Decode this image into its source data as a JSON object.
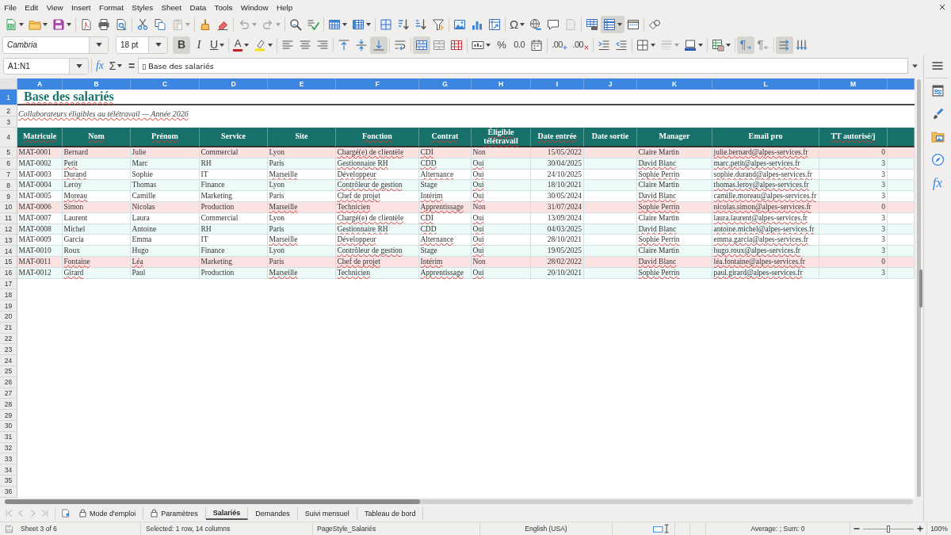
{
  "menu_bar": {
    "items": [
      "File",
      "Edit",
      "View",
      "Insert",
      "Format",
      "Styles",
      "Sheet",
      "Data",
      "Tools",
      "Window",
      "Help"
    ]
  },
  "standard_toolbar": [
    {
      "dropdown": true,
      "pressed": false,
      "disabled": false
    },
    {
      "dropdown": true,
      "pressed": false,
      "disabled": false
    },
    {
      "dropdown": true,
      "pressed": false,
      "disabled": false
    },
    {
      "dropdown": false,
      "pressed": false,
      "disabled": false
    },
    {
      "dropdown": false,
      "pressed": false,
      "disabled": false
    },
    {
      "dropdown": false,
      "pressed": false,
      "disabled": false
    },
    {
      "dropdown": false,
      "pressed": false,
      "disabled": false
    },
    {
      "dropdown": false,
      "pressed": false,
      "disabled": false
    },
    {
      "dropdown": true,
      "pressed": false,
      "disabled": true
    },
    {
      "dropdown": false,
      "pressed": false,
      "disabled": false
    },
    {
      "dropdown": false,
      "pressed": false,
      "disabled": false
    },
    {
      "dropdown": true,
      "pressed": false,
      "disabled": true
    },
    {
      "dropdown": true,
      "pressed": false,
      "disabled": true
    },
    {
      "dropdown": false,
      "pressed": false,
      "disabled": false
    },
    {
      "dropdown": false,
      "pressed": false,
      "disabled": false
    },
    {
      "dropdown": true,
      "pressed": false,
      "disabled": false
    },
    {
      "dropdown": true,
      "pressed": false,
      "disabled": false
    },
    {
      "dropdown": false,
      "pressed": false,
      "disabled": false
    },
    {
      "dropdown": false,
      "pressed": false,
      "disabled": false
    },
    {
      "dropdown": false,
      "pressed": false,
      "disabled": false
    },
    {
      "dropdown": false,
      "pressed": false,
      "disabled": false
    },
    {
      "dropdown": false,
      "pressed": false,
      "disabled": false
    },
    {
      "dropdown": false,
      "pressed": false,
      "disabled": false
    },
    {
      "dropdown": false,
      "pressed": false,
      "disabled": false
    },
    {
      "glyph": "Ω",
      "dropdown": true,
      "pressed": false,
      "disabled": false
    },
    {
      "dropdown": false,
      "pressed": false,
      "disabled": false
    },
    {
      "dropdown": false,
      "pressed": false,
      "disabled": false
    },
    {
      "dropdown": false,
      "pressed": false,
      "disabled": true
    },
    {
      "dropdown": false,
      "pressed": false,
      "disabled": false
    },
    {
      "dropdown": true,
      "pressed": true,
      "disabled": false
    },
    {
      "dropdown": false,
      "pressed": false,
      "disabled": false
    },
    {
      "dropdown": false,
      "pressed": false,
      "disabled": false
    }
  ],
  "formatting_toolbar": {
    "font_name": "Cambria",
    "font_size": "18 pt",
    "buttons": [
      {
        "glyph": "B",
        "dropdown": false,
        "pressed": true,
        "disabled": false
      },
      {
        "glyph": "I",
        "dropdown": false,
        "pressed": false,
        "disabled": false
      },
      {
        "glyph": "U",
        "dropdown": true,
        "pressed": false,
        "disabled": false
      },
      {
        "glyph": "A",
        "dropdown": true,
        "pressed": false,
        "disabled": false
      },
      {
        "dropdown": true,
        "pressed": false,
        "disabled": false
      },
      {
        "dropdown": false,
        "pressed": false,
        "disabled": false
      },
      {
        "dropdown": false,
        "pressed": false,
        "disabled": false
      },
      {
        "dropdown": false,
        "pressed": false,
        "disabled": false
      },
      {
        "dropdown": false,
        "pressed": false,
        "disabled": false
      },
      {
        "dropdown": false,
        "pressed": false,
        "disabled": false
      },
      {
        "dropdown": false,
        "pressed": true,
        "disabled": false
      },
      {
        "dropdown": false,
        "pressed": false,
        "disabled": false
      },
      {
        "dropdown": false,
        "pressed": true,
        "disabled": false
      },
      {
        "dropdown": false,
        "pressed": false,
        "disabled": false
      },
      {
        "dropdown": false,
        "pressed": false,
        "disabled": false
      },
      {
        "dropdown": true,
        "pressed": false,
        "disabled": false
      },
      {
        "glyph": "%",
        "dropdown": false,
        "pressed": false,
        "disabled": false
      },
      {
        "glyph": "0.0",
        "dropdown": false,
        "pressed": false,
        "disabled": false
      },
      {
        "dropdown": false,
        "pressed": false,
        "disabled": false
      },
      {
        "glyph": ".00",
        "dropdown": false,
        "pressed": false,
        "disabled": false
      },
      {
        "glyph": ".00",
        "dropdown": false,
        "pressed": false,
        "disabled": false
      },
      {
        "dropdown": false,
        "pressed": false,
        "disabled": false
      },
      {
        "dropdown": false,
        "pressed": false,
        "disabled": false
      },
      {
        "dropdown": true,
        "pressed": false,
        "disabled": false
      },
      {
        "dropdown": true,
        "pressed": false,
        "disabled": true
      },
      {
        "dropdown": true,
        "pressed": false,
        "disabled": false
      },
      {
        "dropdown": true,
        "pressed": false,
        "disabled": false
      },
      {
        "glyph": "¶",
        "dropdown": false,
        "pressed": true,
        "disabled": false
      },
      {
        "glyph": "¶",
        "dropdown": false,
        "pressed": false,
        "disabled": false
      },
      {
        "dropdown": false,
        "pressed": true,
        "disabled": false
      },
      {
        "dropdown": false,
        "pressed": false,
        "disabled": false
      }
    ]
  },
  "formula_bar": {
    "name_box": "A1:N1",
    "function_wizard": "fx",
    "sum": "Σ",
    "formula": "=",
    "content": "▯ Base des salariés"
  },
  "sheet": {
    "column_headers": [
      {
        "label": "A",
        "selected": true
      },
      {
        "label": "B",
        "selected": true
      },
      {
        "label": "C",
        "selected": true
      },
      {
        "label": "D",
        "selected": true
      },
      {
        "label": "E",
        "selected": true
      },
      {
        "label": "F",
        "selected": true
      },
      {
        "label": "G",
        "selected": true
      },
      {
        "label": "H",
        "selected": true
      },
      {
        "label": "I",
        "selected": true
      },
      {
        "label": "J",
        "selected": true
      },
      {
        "label": "K",
        "selected": true
      },
      {
        "label": "L",
        "selected": true
      },
      {
        "label": "M",
        "selected": true
      }
    ],
    "row_headers": [
      {
        "label": "1",
        "selected": true
      },
      {
        "label": "2",
        "selected": false
      },
      {
        "label": "3",
        "selected": false
      },
      {
        "label": "4",
        "selected": false
      },
      {
        "label": "5",
        "selected": false
      },
      {
        "label": "6",
        "selected": false
      },
      {
        "label": "7",
        "selected": false
      },
      {
        "label": "8",
        "selected": false
      },
      {
        "label": "9",
        "selected": false
      },
      {
        "label": "10",
        "selected": false
      },
      {
        "label": "11",
        "selected": false
      },
      {
        "label": "12",
        "selected": false
      },
      {
        "label": "13",
        "selected": false
      },
      {
        "label": "14",
        "selected": false
      },
      {
        "label": "15",
        "selected": false
      },
      {
        "label": "16",
        "selected": false
      },
      {
        "label": "17",
        "selected": false
      },
      {
        "label": "18",
        "selected": false
      },
      {
        "label": "19",
        "selected": false
      },
      {
        "label": "20",
        "selected": false
      },
      {
        "label": "21",
        "selected": false
      },
      {
        "label": "22",
        "selected": false
      },
      {
        "label": "23",
        "selected": false
      },
      {
        "label": "24",
        "selected": false
      },
      {
        "label": "25",
        "selected": false
      },
      {
        "label": "26",
        "selected": false
      },
      {
        "label": "27",
        "selected": false
      },
      {
        "label": "28",
        "selected": false
      },
      {
        "label": "29",
        "selected": false
      },
      {
        "label": "30",
        "selected": false
      },
      {
        "label": "31",
        "selected": false
      },
      {
        "label": "32",
        "selected": false
      },
      {
        "label": "33",
        "selected": false
      },
      {
        "label": "34",
        "selected": false
      },
      {
        "label": "35",
        "selected": false
      },
      {
        "label": "36",
        "selected": false
      }
    ],
    "title": {
      "text": "Base des salariés",
      "misspelled": true
    },
    "subtitle": {
      "text": "Collaborateurs éligibles au télétravail — Année 2026",
      "misspelled": true
    },
    "columns": [
      {
        "label": "Matricule",
        "misspelled": true
      },
      {
        "label": "Nom",
        "misspelled": true
      },
      {
        "label": "Prénom",
        "misspelled": true
      },
      {
        "label": "Service",
        "misspelled": false
      },
      {
        "label": "Site",
        "misspelled": false
      },
      {
        "label": "Fonction",
        "misspelled": true
      },
      {
        "label": "Contrat",
        "misspelled": true
      },
      {
        "label": "Éligible télétravail",
        "misspelled": true
      },
      {
        "label": "Date entrée",
        "misspelled": true
      },
      {
        "label": "Date sortie",
        "misspelled": false
      },
      {
        "label": "Manager",
        "misspelled": false
      },
      {
        "label": "Email pro",
        "misspelled": false
      },
      {
        "label": "TT autorisé/j",
        "misspelled": true
      }
    ],
    "rows": [
      {
        "highlighted": true,
        "matricule": {
          "text": "MAT-0001",
          "misspelled": false
        },
        "nom": {
          "text": "Bernard",
          "misspelled": false
        },
        "prenom": {
          "text": "Julie",
          "misspelled": false
        },
        "service": {
          "text": "Commercial",
          "misspelled": false
        },
        "site": {
          "text": "Lyon",
          "misspelled": false
        },
        "fonction": {
          "text": "Chargé(e) de clientèle",
          "misspelled": true
        },
        "contrat": {
          "text": "CDI",
          "misspelled": true
        },
        "eligible": {
          "text": "Non",
          "misspelled": false
        },
        "date_entree": {
          "text": "15/05/2022",
          "misspelled": false
        },
        "manager": {
          "text": "Claire Martin",
          "misspelled": false
        },
        "email": {
          "text": "julie.bernard@alpes-services.fr",
          "misspelled": true
        },
        "tt": {
          "text": "0",
          "misspelled": false
        }
      },
      {
        "highlighted": false,
        "matricule": {
          "text": "MAT-0002",
          "misspelled": false
        },
        "nom": {
          "text": "Petit",
          "misspelled": true
        },
        "prenom": {
          "text": "Marc",
          "misspelled": false
        },
        "service": {
          "text": "RH",
          "misspelled": false
        },
        "site": {
          "text": "Paris",
          "misspelled": false
        },
        "fonction": {
          "text": "Gestionnaire RH",
          "misspelled": true
        },
        "contrat": {
          "text": "CDD",
          "misspelled": true
        },
        "eligible": {
          "text": "Oui",
          "misspelled": true
        },
        "date_entree": {
          "text": "30/04/2025",
          "misspelled": false
        },
        "manager": {
          "text": "David Blanc",
          "misspelled": true
        },
        "email": {
          "text": "marc.petit@alpes-services.fr",
          "misspelled": true
        },
        "tt": {
          "text": "3",
          "misspelled": false
        }
      },
      {
        "highlighted": false,
        "matricule": {
          "text": "MAT-0003",
          "misspelled": false
        },
        "nom": {
          "text": "Durand",
          "misspelled": true
        },
        "prenom": {
          "text": "Sophie",
          "misspelled": false
        },
        "service": {
          "text": "IT",
          "misspelled": false
        },
        "site": {
          "text": "Marseille",
          "misspelled": true
        },
        "fonction": {
          "text": "Développeur",
          "misspelled": true
        },
        "contrat": {
          "text": "Alternance",
          "misspelled": true
        },
        "eligible": {
          "text": "Oui",
          "misspelled": true
        },
        "date_entree": {
          "text": "24/10/2025",
          "misspelled": false
        },
        "manager": {
          "text": "Sophie Perrin",
          "misspelled": true
        },
        "email": {
          "text": "sophie.durand@alpes-services.fr",
          "misspelled": true
        },
        "tt": {
          "text": "3",
          "misspelled": false
        }
      },
      {
        "highlighted": false,
        "matricule": {
          "text": "MAT-0004",
          "misspelled": false
        },
        "nom": {
          "text": "Leroy",
          "misspelled": false
        },
        "prenom": {
          "text": "Thomas",
          "misspelled": false
        },
        "service": {
          "text": "Finance",
          "misspelled": false
        },
        "site": {
          "text": "Lyon",
          "misspelled": false
        },
        "fonction": {
          "text": "Contrôleur de gestion",
          "misspelled": true
        },
        "contrat": {
          "text": "Stage",
          "misspelled": false
        },
        "eligible": {
          "text": "Oui",
          "misspelled": true
        },
        "date_entree": {
          "text": "18/10/2021",
          "misspelled": false
        },
        "manager": {
          "text": "Claire Martin",
          "misspelled": false
        },
        "email": {
          "text": "thomas.leroy@alpes-services.fr",
          "misspelled": true
        },
        "tt": {
          "text": "3",
          "misspelled": false
        }
      },
      {
        "highlighted": false,
        "matricule": {
          "text": "MAT-0005",
          "misspelled": false
        },
        "nom": {
          "text": "Moreau",
          "misspelled": true
        },
        "prenom": {
          "text": "Camille",
          "misspelled": false
        },
        "service": {
          "text": "Marketing",
          "misspelled": false
        },
        "site": {
          "text": "Paris",
          "misspelled": false
        },
        "fonction": {
          "text": "Chef de projet",
          "misspelled": true
        },
        "contrat": {
          "text": "Intérim",
          "misspelled": true
        },
        "eligible": {
          "text": "Oui",
          "misspelled": true
        },
        "date_entree": {
          "text": "30/05/2024",
          "misspelled": false
        },
        "manager": {
          "text": "David Blanc",
          "misspelled": true
        },
        "email": {
          "text": "camille.moreau@alpes-services.fr",
          "misspelled": true
        },
        "tt": {
          "text": "3",
          "misspelled": false
        }
      },
      {
        "highlighted": true,
        "matricule": {
          "text": "MAT-0006",
          "misspelled": false
        },
        "nom": {
          "text": "Simon",
          "misspelled": false
        },
        "prenom": {
          "text": "Nicolas",
          "misspelled": false
        },
        "service": {
          "text": "Production",
          "misspelled": false
        },
        "site": {
          "text": "Marseille",
          "misspelled": true
        },
        "fonction": {
          "text": "Technicien",
          "misspelled": true
        },
        "contrat": {
          "text": "Apprentissage",
          "misspelled": true
        },
        "eligible": {
          "text": "Non",
          "misspelled": false
        },
        "date_entree": {
          "text": "31/07/2024",
          "misspelled": false
        },
        "manager": {
          "text": "Sophie Perrin",
          "misspelled": true
        },
        "email": {
          "text": "nicolas.simon@alpes-services.fr",
          "misspelled": true
        },
        "tt": {
          "text": "0",
          "misspelled": false
        }
      },
      {
        "highlighted": false,
        "matricule": {
          "text": "MAT-0007",
          "misspelled": false
        },
        "nom": {
          "text": "Laurent",
          "misspelled": false
        },
        "prenom": {
          "text": "Laura",
          "misspelled": false
        },
        "service": {
          "text": "Commercial",
          "misspelled": false
        },
        "site": {
          "text": "Lyon",
          "misspelled": false
        },
        "fonction": {
          "text": "Chargé(e) de clientèle",
          "misspelled": true
        },
        "contrat": {
          "text": "CDI",
          "misspelled": true
        },
        "eligible": {
          "text": "Oui",
          "misspelled": true
        },
        "date_entree": {
          "text": "13/09/2024",
          "misspelled": false
        },
        "manager": {
          "text": "Claire Martin",
          "misspelled": false
        },
        "email": {
          "text": "laura.laurent@alpes-services.fr",
          "misspelled": true
        },
        "tt": {
          "text": "3",
          "misspelled": false
        }
      },
      {
        "highlighted": false,
        "matricule": {
          "text": "MAT-0008",
          "misspelled": false
        },
        "nom": {
          "text": "Michel",
          "misspelled": false
        },
        "prenom": {
          "text": "Antoine",
          "misspelled": false
        },
        "service": {
          "text": "RH",
          "misspelled": false
        },
        "site": {
          "text": "Paris",
          "misspelled": false
        },
        "fonction": {
          "text": "Gestionnaire RH",
          "misspelled": true
        },
        "contrat": {
          "text": "CDD",
          "misspelled": true
        },
        "eligible": {
          "text": "Oui",
          "misspelled": true
        },
        "date_entree": {
          "text": "04/03/2025",
          "misspelled": false
        },
        "manager": {
          "text": "David Blanc",
          "misspelled": true
        },
        "email": {
          "text": "antoine.michel@alpes-services.fr",
          "misspelled": true
        },
        "tt": {
          "text": "3",
          "misspelled": false
        }
      },
      {
        "highlighted": false,
        "matricule": {
          "text": "MAT-0009",
          "misspelled": false
        },
        "nom": {
          "text": "Garcia",
          "misspelled": false
        },
        "prenom": {
          "text": "Emma",
          "misspelled": false
        },
        "service": {
          "text": "IT",
          "misspelled": false
        },
        "site": {
          "text": "Marseille",
          "misspelled": true
        },
        "fonction": {
          "text": "Développeur",
          "misspelled": true
        },
        "contrat": {
          "text": "Alternance",
          "misspelled": true
        },
        "eligible": {
          "text": "Oui",
          "misspelled": true
        },
        "date_entree": {
          "text": "28/10/2021",
          "misspelled": false
        },
        "manager": {
          "text": "Sophie Perrin",
          "misspelled": true
        },
        "email": {
          "text": "emma.garcia@alpes-services.fr",
          "misspelled": true
        },
        "tt": {
          "text": "3",
          "misspelled": false
        }
      },
      {
        "highlighted": false,
        "matricule": {
          "text": "MAT-0010",
          "misspelled": false
        },
        "nom": {
          "text": "Roux",
          "misspelled": false
        },
        "prenom": {
          "text": "Hugo",
          "misspelled": false
        },
        "service": {
          "text": "Finance",
          "misspelled": false
        },
        "site": {
          "text": "Lyon",
          "misspelled": false
        },
        "fonction": {
          "text": "Contrôleur de gestion",
          "misspelled": true
        },
        "contrat": {
          "text": "Stage",
          "misspelled": false
        },
        "eligible": {
          "text": "Oui",
          "misspelled": true
        },
        "date_entree": {
          "text": "19/05/2025",
          "misspelled": false
        },
        "manager": {
          "text": "Claire Martin",
          "misspelled": false
        },
        "email": {
          "text": "hugo.roux@alpes-services.fr",
          "misspelled": true
        },
        "tt": {
          "text": "3",
          "misspelled": false
        }
      },
      {
        "highlighted": true,
        "matricule": {
          "text": "MAT-0011",
          "misspelled": false
        },
        "nom": {
          "text": "Fontaine",
          "misspelled": true
        },
        "prenom": {
          "text": "Léa",
          "misspelled": true
        },
        "service": {
          "text": "Marketing",
          "misspelled": false
        },
        "site": {
          "text": "Paris",
          "misspelled": false
        },
        "fonction": {
          "text": "Chef de projet",
          "misspelled": true
        },
        "contrat": {
          "text": "Intérim",
          "misspelled": true
        },
        "eligible": {
          "text": "Non",
          "misspelled": false
        },
        "date_entree": {
          "text": "28/02/2022",
          "misspelled": false
        },
        "manager": {
          "text": "David Blanc",
          "misspelled": true
        },
        "email": {
          "text": "léa.fontaine@alpes-services.fr",
          "misspelled": true
        },
        "tt": {
          "text": "0",
          "misspelled": false
        }
      },
      {
        "highlighted": false,
        "matricule": {
          "text": "MAT-0012",
          "misspelled": false
        },
        "nom": {
          "text": "Girard",
          "misspelled": true
        },
        "prenom": {
          "text": "Paul",
          "misspelled": false
        },
        "service": {
          "text": "Production",
          "misspelled": false
        },
        "site": {
          "text": "Marseille",
          "misspelled": true
        },
        "fonction": {
          "text": "Technicien",
          "misspelled": true
        },
        "contrat": {
          "text": "Apprentissage",
          "misspelled": true
        },
        "eligible": {
          "text": "Oui",
          "misspelled": true
        },
        "date_entree": {
          "text": "20/10/2021",
          "misspelled": false
        },
        "manager": {
          "text": "Sophie Perrin",
          "misspelled": true
        },
        "email": {
          "text": "paul.girard@alpes-services.fr",
          "misspelled": true
        },
        "tt": {
          "text": "3",
          "misspelled": false
        }
      }
    ]
  },
  "sidebar": {
    "functions_tab": "fx"
  },
  "sheet_navigation": [
    {
      "disabled": true
    },
    {
      "disabled": true
    },
    {
      "disabled": true
    },
    {
      "disabled": true
    }
  ],
  "sheet_tabs": [
    {
      "label": "Mode d'emploi",
      "locked": true,
      "selected": false
    },
    {
      "label": "Paramètres",
      "locked": true,
      "selected": false
    },
    {
      "label": "Salariés",
      "locked": false,
      "selected": true
    },
    {
      "label": "Demandes",
      "locked": false,
      "selected": false
    },
    {
      "label": "Suivi mensuel",
      "locked": false,
      "selected": false
    },
    {
      "label": "Tableau de bord",
      "locked": false,
      "selected": false
    }
  ],
  "status_bar": {
    "sheet": "Sheet 3 of 6",
    "selection": "Selected: 1 row, 14 columns",
    "page_style": "PageStyle_Salariés",
    "language": "English (USA)",
    "statistics": "Average: ; Sum: 0",
    "zoom_slider": {
      "level": 0.5
    },
    "zoom": "100%"
  }
}
